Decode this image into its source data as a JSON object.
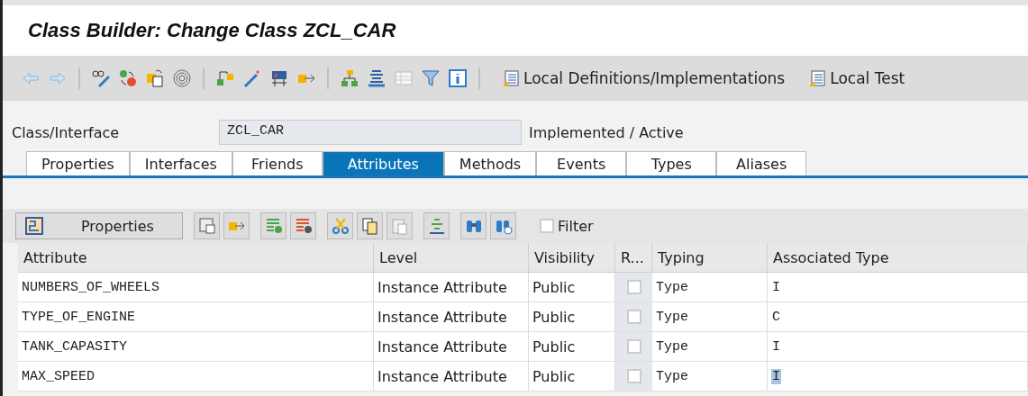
{
  "window": {
    "title": "Class Builder: Change Class ZCL_CAR"
  },
  "toolbar": {
    "buttons": [
      {
        "label": "Local Definitions/Implementations"
      },
      {
        "label": "Local Test"
      }
    ]
  },
  "header": {
    "label": "Class/Interface",
    "value": "ZCL_CAR",
    "status": "Implemented / Active"
  },
  "tabs": [
    {
      "label": "Properties",
      "selected": false
    },
    {
      "label": "Interfaces",
      "selected": false
    },
    {
      "label": "Friends",
      "selected": false
    },
    {
      "label": "Attributes",
      "selected": true
    },
    {
      "label": "Methods",
      "selected": false
    },
    {
      "label": "Events",
      "selected": false
    },
    {
      "label": "Types",
      "selected": false
    },
    {
      "label": "Aliases",
      "selected": false
    }
  ],
  "table_toolbar": {
    "properties_button": "Properties",
    "filter": {
      "label": "Filter",
      "checked": false
    }
  },
  "table": {
    "columns": [
      "Attribute",
      "Level",
      "Visibility",
      "R...",
      "Typing",
      "Associated Type"
    ],
    "rows": [
      {
        "attribute": "NUMBERS_OF_WHEELS",
        "level": "Instance Attribute",
        "visibility": "Public",
        "read_only": false,
        "typing": "Type",
        "associated_type": "I",
        "highlighted": false
      },
      {
        "attribute": "TYPE_OF_ENGINE",
        "level": "Instance Attribute",
        "visibility": "Public",
        "read_only": false,
        "typing": "Type",
        "associated_type": "C",
        "highlighted": false
      },
      {
        "attribute": "TANK_CAPASITY",
        "level": "Instance Attribute",
        "visibility": "Public",
        "read_only": false,
        "typing": "Type",
        "associated_type": "I",
        "highlighted": false
      },
      {
        "attribute": "MAX_SPEED",
        "level": "Instance Attribute",
        "visibility": "Public",
        "read_only": false,
        "typing": "Type",
        "associated_type": "I",
        "highlighted": true
      }
    ]
  }
}
